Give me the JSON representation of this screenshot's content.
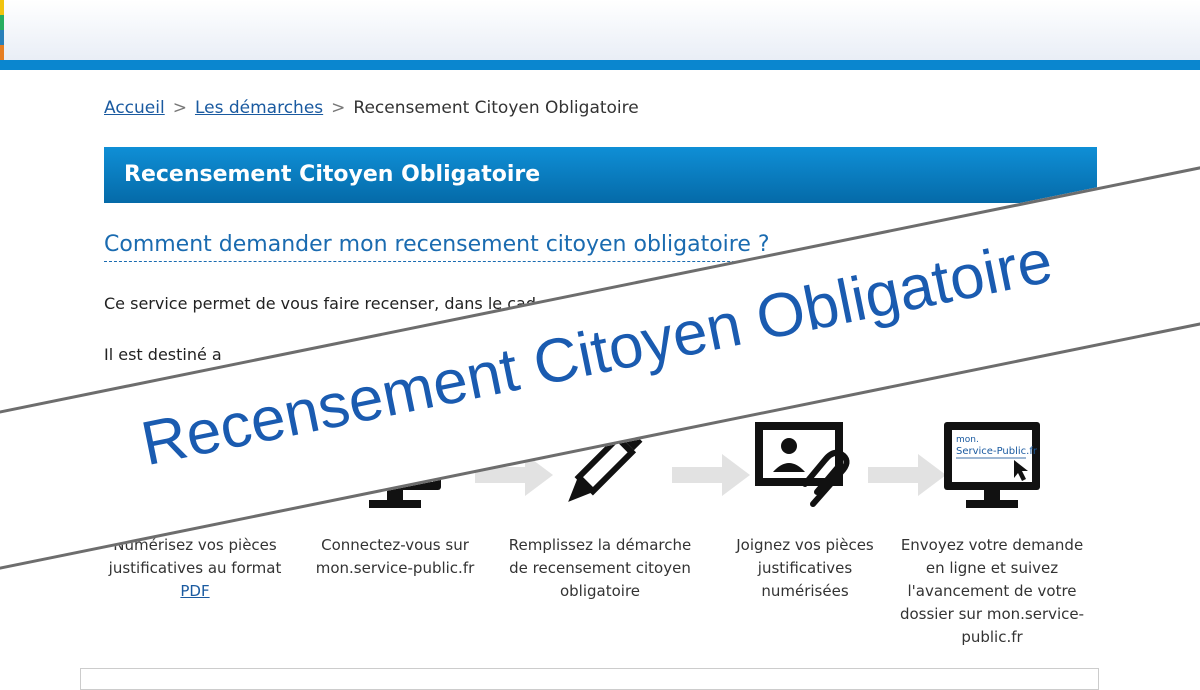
{
  "breadcrumb": {
    "home": "Accueil",
    "demarches": "Les démarches",
    "current": "Recensement Citoyen Obligatoire",
    "separator": ">"
  },
  "banner": {
    "title": "Recensement Citoyen Obligatoire"
  },
  "question": {
    "title": "Comment demander mon recensement citoyen obligatoire ?"
  },
  "paragraphs": {
    "p1": "Ce service permet de vous faire recenser, dans le cad",
    "p2": "Il est destiné a"
  },
  "overlay": {
    "text": "Recensement Citoyen Obligatoire"
  },
  "steps": {
    "s1": {
      "line1": "Numérisez vos pièces",
      "line2": "justificatives au format",
      "link": "PDF"
    },
    "s2": {
      "line1": "Connectez-vous sur",
      "line2": "mon.service-public.fr"
    },
    "s3": {
      "line1": "Remplissez la démarche",
      "line2": "de recensement citoyen",
      "line3": "obligatoire"
    },
    "s4": {
      "line1": "Joignez vos pièces",
      "line2": "justificatives",
      "line3": "numérisées"
    },
    "s5": {
      "line1": "Envoyez votre demande",
      "line2": "en ligne et suivez",
      "line3": "l'avancement de votre",
      "line4": "dossier sur mon.service-",
      "line5": "public.fr",
      "screen_mon": "mon.",
      "screen_sp": "Service-Public.fr"
    }
  },
  "colors": {
    "accent": "#0a86cf",
    "link": "#1a5aa0",
    "heading": "#1a6bb0",
    "overlay_text": "#1a5bb0"
  },
  "icons": [
    "scanner-icon",
    "computer-cursor-icon",
    "pencil-icon",
    "id-card-paperclip-icon",
    "service-public-monitor-icon",
    "arrow-right-icon"
  ]
}
